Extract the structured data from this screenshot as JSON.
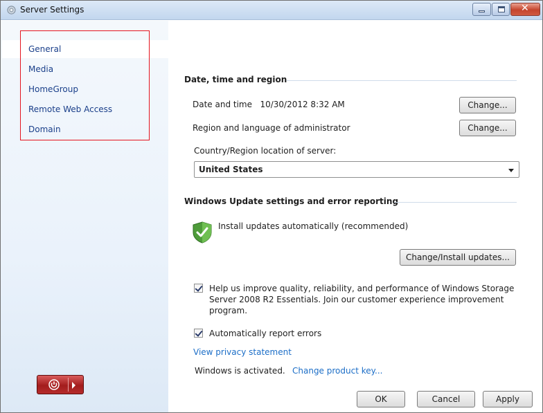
{
  "window": {
    "title": "Server Settings"
  },
  "sidebar": {
    "items": [
      {
        "label": "General",
        "active": true
      },
      {
        "label": "Media"
      },
      {
        "label": "HomeGroup"
      },
      {
        "label": "Remote Web Access"
      },
      {
        "label": "Domain"
      }
    ]
  },
  "date_section": {
    "title": "Date, time and region",
    "date_label": "Date and time",
    "date_value": "10/30/2012 8:32 AM",
    "change_date_label": "Change...",
    "region_label": "Region and language of administrator",
    "change_region_label": "Change...",
    "country_label": "Country/Region location of server:",
    "country_value": "United States"
  },
  "update_section": {
    "title": "Windows Update settings and error reporting",
    "status_text": "Install updates automatically (recommended)",
    "change_install_label": "Change/Install updates...",
    "ceip_text": "Help us improve quality, reliability, and performance of Windows Storage Server 2008 R2 Essentials. Join our customer experience improvement program.",
    "ceip_checked": true,
    "report_text": "Automatically report errors",
    "report_checked": true,
    "privacy_link": "View privacy statement",
    "activation_text": "Windows is activated.",
    "product_key_link": "Change product key..."
  },
  "footer": {
    "ok_label": "OK",
    "cancel_label": "Cancel",
    "apply_label": "Apply"
  },
  "colors": {
    "link": "#1c6ec7",
    "nav_text": "#1a3f8a",
    "highlight_box": "#e4141e"
  }
}
